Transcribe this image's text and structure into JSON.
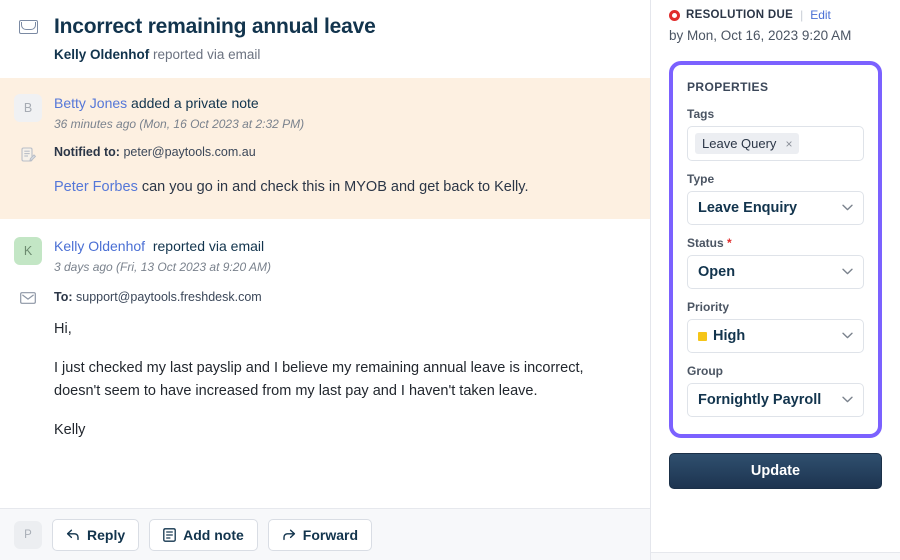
{
  "ticket": {
    "icon": "envelope-icon",
    "title": "Incorrect remaining annual leave",
    "reporter": "Kelly Oldenhof",
    "reported_via": "reported via email"
  },
  "conversation": [
    {
      "kind": "private-note",
      "avatar_initial": "B",
      "author": "Betty Jones",
      "action": " added a private note",
      "timestamp": "36 minutes ago (Mon, 16 Oct 2023 at 2:32 PM)",
      "notified_label": "Notified to:",
      "notified_value": " peter@paytools.com.au",
      "mention": "Peter Forbes",
      "body": " can you go in and check this in MYOB and get back to Kelly."
    },
    {
      "kind": "email",
      "avatar_initial": "K",
      "author": "Kelly Oldenhof",
      "action": " reported via email",
      "timestamp": "3 days ago (Fri, 13 Oct 2023 at 9:20 AM)",
      "to_label": "To:",
      "to_value": " support@paytools.freshdesk.com",
      "paragraphs": [
        "Hi,",
        "I just checked my last payslip and I believe my remaining annual leave is incorrect, doesn't seem to have increased from my last pay and I haven't taken leave.",
        "Kelly"
      ]
    }
  ],
  "action_bar": {
    "agent_initial": "P",
    "buttons": [
      {
        "label": "Reply",
        "icon": "reply-arrow-icon"
      },
      {
        "label": "Add note",
        "icon": "note-icon"
      },
      {
        "label": "Forward",
        "icon": "forward-arrow-icon"
      }
    ]
  },
  "sidebar": {
    "resolution": {
      "status_icon": "red-circle-icon",
      "label": "RESOLUTION DUE",
      "separator": "|",
      "edit_label": "Edit",
      "due": "by Mon, Oct 16, 2023 9:20 AM"
    },
    "properties": {
      "title": "PROPERTIES",
      "highlight_color": "#7b61ff",
      "tags": {
        "label": "Tags",
        "chips": [
          {
            "text": "Leave Query",
            "remove": "×"
          }
        ]
      },
      "type": {
        "label": "Type",
        "value": "Leave Enquiry",
        "chevron": "⌄"
      },
      "status": {
        "label": "Status",
        "required": "*",
        "value": "Open",
        "chevron": "⌄"
      },
      "priority": {
        "label": "Priority",
        "value": "High",
        "swatch": "#f5c518",
        "chevron": "⌄"
      },
      "group": {
        "label": "Group",
        "value": "Fornightly Payroll",
        "chevron": "⌄"
      }
    },
    "update_button": "Update"
  }
}
